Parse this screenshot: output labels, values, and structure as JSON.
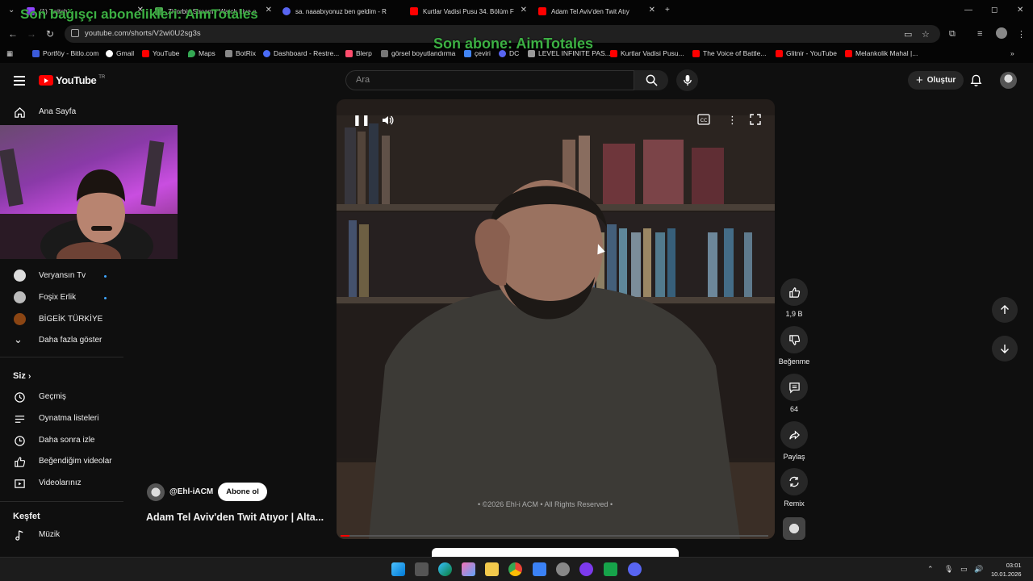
{
  "browser": {
    "tabs": [
      {
        "title": "(1) Twitch",
        "color": "#9146ff"
      },
      {
        "title": "Zivorbin Stream - Watch Live o",
        "color": "#4caf50"
      },
      {
        "title": "sa. naaabıyonuz ben geldim - R",
        "color": "#5865f2"
      },
      {
        "title": "Kurtlar Vadisi Pusu 34. Bölüm F",
        "color": "#ff0000"
      },
      {
        "title": "Adam Tel Aviv'den Twit Atıy",
        "color": "#ff0000"
      }
    ],
    "url": "youtube.com/shorts/V2wi0U2sg3s",
    "bookmarks": [
      {
        "label": "Portföy - Bitlo.com",
        "color": "#3b5bdb"
      },
      {
        "label": "Gmail",
        "color": "#ffffff"
      },
      {
        "label": "YouTube",
        "color": "#ff0000"
      },
      {
        "label": "Maps",
        "color": "#34a853"
      },
      {
        "label": "BotRix",
        "color": "#888888"
      },
      {
        "label": "Dashboard - Restre...",
        "color": "#4a6cf7"
      },
      {
        "label": "Blerp",
        "color": "#ff4d6d"
      },
      {
        "label": "görsel boyutlandırma",
        "color": "#777777"
      },
      {
        "label": "çeviri",
        "color": "#4285f4"
      },
      {
        "label": "DC",
        "color": "#5865f2"
      },
      {
        "label": "LEVEL INFINITE PAS...",
        "color": "#999999"
      },
      {
        "label": "Kurtlar Vadisi Pusu...",
        "color": "#ff0000"
      },
      {
        "label": "The Voice of Battle...",
        "color": "#ff0000"
      },
      {
        "label": "Glitnir - YouTube",
        "color": "#ff0000"
      },
      {
        "label": "Melankolik Mahal |...",
        "color": "#ff0000"
      }
    ]
  },
  "overlay": {
    "top_text": "Son bağışçı abonelikleri: AimTotales",
    "mid_text": "Son abone: AimTotales"
  },
  "header": {
    "logo_text": "YouTube",
    "logo_region": "TR",
    "search_placeholder": "Ara",
    "create_label": "Oluştur"
  },
  "sidebar": {
    "home": "Ana Sayfa",
    "subscriptions": [
      {
        "name": "Veryansın Tv",
        "color": "#dddddd"
      },
      {
        "name": "Foşix Erlik",
        "color": "#bbbbbb"
      },
      {
        "name": "BİGEİK TÜRKİYE",
        "color": "#8b4513"
      }
    ],
    "show_more": "Daha fazla göster",
    "you_heading": "Siz",
    "you_items": [
      "Geçmiş",
      "Oynatma listeleri",
      "Daha sonra izle",
      "Beğendiğim videolar",
      "Videolarınız"
    ],
    "explore_heading": "Keşfet",
    "explore_items": [
      "Müzik"
    ]
  },
  "video": {
    "copyright": "• ©2026 Ehl-i ACM • All Rights Reserved •",
    "channel": "@Ehl-iACM",
    "subscribe": "Abone ol",
    "title": "Adam Tel Aviv'den Twit Atıyor | Alta...",
    "progress": 0.02
  },
  "actions": {
    "likes": "1,9 B",
    "dislike": "Beğenme",
    "comments": "64",
    "share": "Paylaş",
    "remix": "Remix"
  },
  "taskbar": {
    "time": "03:01",
    "date": "10.01.2026"
  }
}
